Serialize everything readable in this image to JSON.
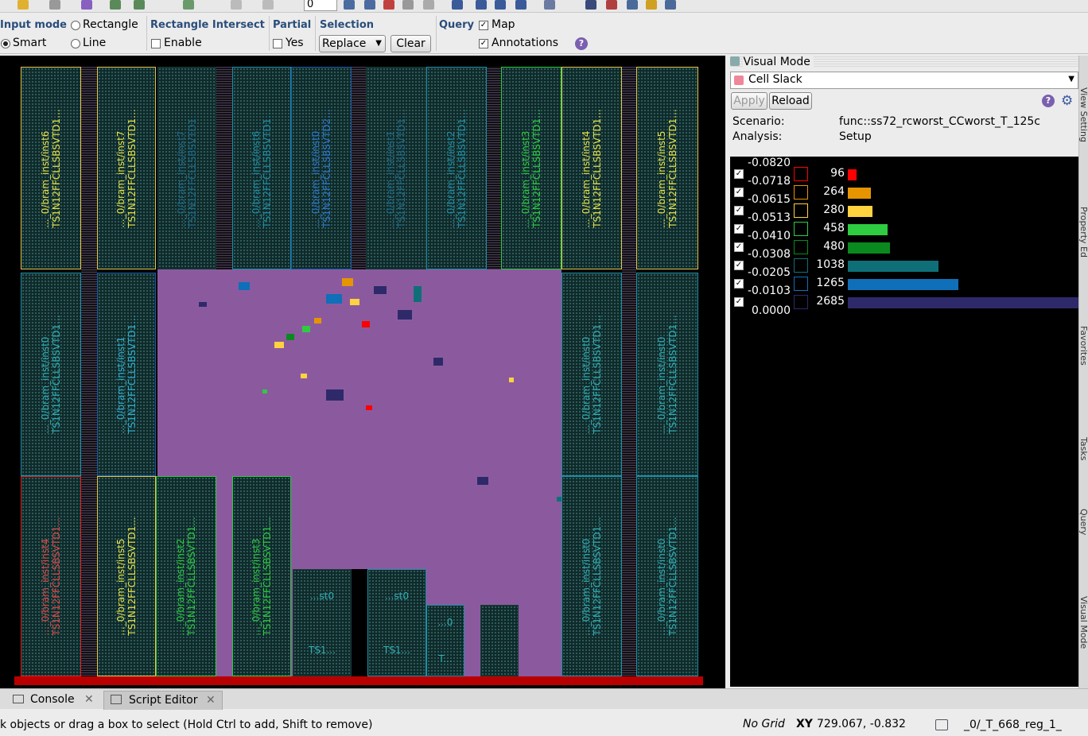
{
  "toolbar": {
    "zoom_value": "0"
  },
  "options": {
    "input_mode": {
      "title": "Input mode",
      "rectangle": "Rectangle",
      "smart": "Smart",
      "line": "Line"
    },
    "rect_intersect": {
      "title": "Rectangle Intersect",
      "enable": "Enable"
    },
    "partial": {
      "title": "Partial",
      "yes": "Yes"
    },
    "selection": {
      "title": "Selection",
      "mode": "Replace",
      "clear": "Clear"
    },
    "query": {
      "title": "Query",
      "map": "Map",
      "annotations": "Annotations"
    }
  },
  "layout": {
    "blocks_top": [
      {
        "label": "..._0/bram_inst/inst6",
        "type": "TS1N12FFCLLSBSVTD1..."
      },
      {
        "label": "..._0/bram_inst/inst7",
        "type": "TS1N12FFCLLSBSVTD1..."
      },
      {
        "label": "..._0/bram_inst/inst7",
        "type": "TS1N12FFCLLSBSVTD1..."
      },
      {
        "label": "..._0/bram_inst/inst6",
        "type": "TS1N12FFCLLSBSVTD1..."
      },
      {
        "label": "..._0/bram_inst/inst0",
        "type": "TS1N12FFCLLSBSVTD2..."
      },
      {
        "label": "..._0/bram_inst/inst1",
        "type": "TS1N12FFCLLSBSVTD1..."
      },
      {
        "label": "..._0/bram_inst/inst2",
        "type": "TS1N12FFCLLSBSVTD1..."
      },
      {
        "label": "..._0/bram_inst/inst3",
        "type": "TS1N12FFCLLSBSVTD1..."
      },
      {
        "label": "..._0/bram_inst/inst4",
        "type": "TS1N12FFCLLSBSVTD1..."
      },
      {
        "label": "..._0/bram_inst/inst5",
        "type": "TS1N12FFCLLSBSVTD1..."
      }
    ],
    "blocks_mid": [
      {
        "label": "..._0/bram_inst/inst0",
        "type": "TS1N12FFCLLSBSVTD1..."
      },
      {
        "label": "..._0/bram_inst/inst1",
        "type": "TS1N12FFCLLSBSVTD1..."
      },
      {
        "label": "..._0/bram_inst/inst0",
        "type": "TS1N12FFCLLSBSVTD1..."
      },
      {
        "label": "..._0/bram_inst/inst0",
        "type": "TS1N12FFCLLSBSVTD1..."
      }
    ],
    "blocks_bot": [
      {
        "label": "..._0/bram_inst/inst4",
        "type": "TS1N12FFCLLSBSVTD1..."
      },
      {
        "label": "..._0/bram_inst/inst5",
        "type": "TS1N12FFCLLSBSVTD1..."
      },
      {
        "label": "..._0/bram_inst/inst2",
        "type": "TS1N12FFCLLSBSVTD1..."
      },
      {
        "label": "..._0/bram_inst/inst3",
        "type": "TS1N12FFCLLSBSVTD1..."
      },
      {
        "label": "..._0/bram_inst/inst0",
        "type": "TS1N12FFCLLSBSVTD1..."
      },
      {
        "label": "..._0/bram_inst/inst0",
        "type": "TS1N12FFCLLSBSVTD1..."
      }
    ],
    "small_blocks": [
      {
        "top": "...st0",
        "bottom": "TS1..."
      },
      {
        "top": "...st0",
        "bottom": "TS1..."
      },
      {
        "top": "...0",
        "bottom": "T..."
      }
    ]
  },
  "panel": {
    "title": "Visual Mode",
    "mode": "Cell Slack",
    "apply": "Apply",
    "reload": "Reload",
    "scenario_label": "Scenario:",
    "scenario_value": "func::ss72_rcworst_CCworst_T_125c",
    "analysis_label": "Analysis:",
    "analysis_value": "Setup",
    "legend": [
      {
        "threshold": "-0.0820",
        "count": "96",
        "value": 96,
        "color": "#ff0000"
      },
      {
        "threshold": "-0.0718",
        "count": "264",
        "value": 264,
        "color": "#e69500"
      },
      {
        "threshold": "-0.0615",
        "count": "280",
        "value": 280,
        "color": "#ffd23f"
      },
      {
        "threshold": "-0.0513",
        "count": "458",
        "value": 458,
        "color": "#2ecc40"
      },
      {
        "threshold": "-0.0410",
        "count": "480",
        "value": 480,
        "color": "#0a8a1e"
      },
      {
        "threshold": "-0.0308",
        "count": "1038",
        "value": 1038,
        "color": "#0f6f78"
      },
      {
        "threshold": "-0.0205",
        "count": "1265",
        "value": 1265,
        "color": "#0f6fb8"
      },
      {
        "threshold": "-0.0103",
        "count": "2685",
        "value": 2685,
        "color": "#2e2a6a"
      }
    ],
    "legend_last": "0.0000"
  },
  "side_tabs": [
    "View Setting",
    "Property Ed",
    "Favorites",
    "Tasks",
    "Query",
    "Visual Mode"
  ],
  "bottom_tabs": {
    "console": "Console",
    "script": "Script Editor"
  },
  "status": {
    "hint": "k objects or drag a box to select (Hold Ctrl to add, Shift to remove)",
    "grid": "No Grid",
    "xy_label": "XY",
    "xy_value": "729.067, -0.832",
    "object": "_0/_T_668_reg_1_"
  }
}
